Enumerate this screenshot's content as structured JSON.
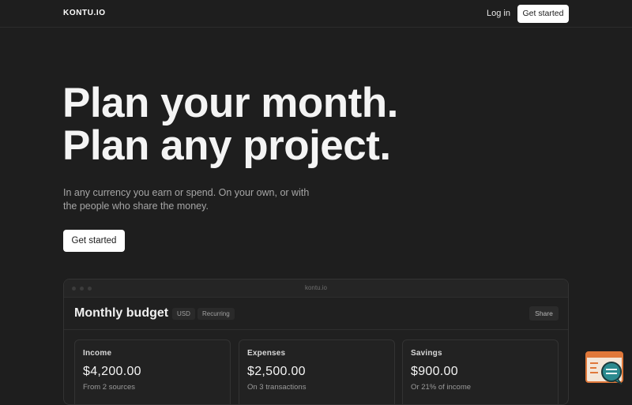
{
  "header": {
    "logo": "KONTU.IO",
    "login_label": "Log in",
    "cta_label": "Get started"
  },
  "hero": {
    "title_line1": "Plan your month.",
    "title_line2": "Plan any project.",
    "subtitle": "In any currency you earn or spend. On your own, or with the people who share the money.",
    "cta_label": "Get started"
  },
  "preview": {
    "url": "kontu.io",
    "title": "Monthly budget",
    "currency_chip": "USD",
    "recurring_chip": "Recurring",
    "share_label": "Share",
    "cards": [
      {
        "label": "Income",
        "value": "$4,200.00",
        "note": "From 2 sources"
      },
      {
        "label": "Expenses",
        "value": "$2,500.00",
        "note": "On 3 transactions"
      },
      {
        "label": "Savings",
        "value": "$900.00",
        "note": "Or 21% of income"
      }
    ]
  },
  "colors": {
    "background": "#1e1e1e",
    "button_bg": "#ffffff",
    "widget_accent": "#e0783a",
    "widget_teal": "#2b8a8f"
  },
  "icons": {
    "feedback_widget": "chat-bubble-icon"
  }
}
